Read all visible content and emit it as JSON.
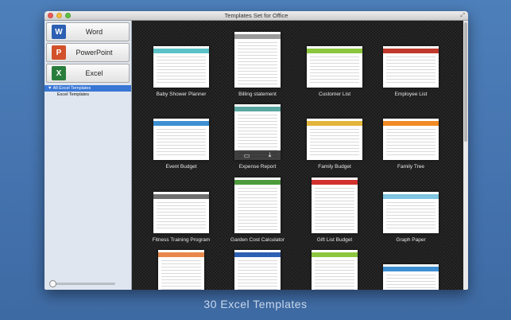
{
  "window": {
    "title": "Templates Set for Office"
  },
  "sidebar": {
    "apps": [
      {
        "label": "Word",
        "icon": "word-app-icon",
        "glyph": "W",
        "color": "#2d5fb3"
      },
      {
        "label": "PowerPoint",
        "icon": "powerpoint-app-icon",
        "glyph": "P",
        "color": "#d2512b"
      },
      {
        "label": "Excel",
        "icon": "excel-app-icon",
        "glyph": "X",
        "color": "#2a7e3c"
      }
    ],
    "tree": {
      "root": "▼ All Excel Templates",
      "child": "Excel Templates"
    }
  },
  "templates": [
    {
      "name": "Baby Shower Planner",
      "accent": "#5bc3c7"
    },
    {
      "name": "Billing statement",
      "accent": "#9a9a9a"
    },
    {
      "name": "Customer List",
      "accent": "#8cc63e"
    },
    {
      "name": "Employee List",
      "accent": "#c0392b"
    },
    {
      "name": "Event Budget",
      "accent": "#3d8fd1"
    },
    {
      "name": "Expense Report",
      "accent": "#5aa7a0"
    },
    {
      "name": "Family Budget",
      "accent": "#e2b43a"
    },
    {
      "name": "Family Tree",
      "accent": "#f08a24"
    },
    {
      "name": "Fitness Training Program",
      "accent": "#6e6e6e"
    },
    {
      "name": "Garden Cost Calculator",
      "accent": "#4c9a3c"
    },
    {
      "name": "Gift List Budget",
      "accent": "#d2322d"
    },
    {
      "name": "Graph Paper",
      "accent": "#7fc4e0"
    },
    {
      "name": "",
      "accent": "#e8874a"
    },
    {
      "name": "",
      "accent": "#2d5fb3"
    },
    {
      "name": "",
      "accent": "#8cc63e"
    },
    {
      "name": "",
      "accent": "#3d8fd1"
    }
  ],
  "footer": {
    "text": "30 Excel Templates"
  },
  "colors": {
    "selection": "#3876d5",
    "background": "#4472ad"
  }
}
